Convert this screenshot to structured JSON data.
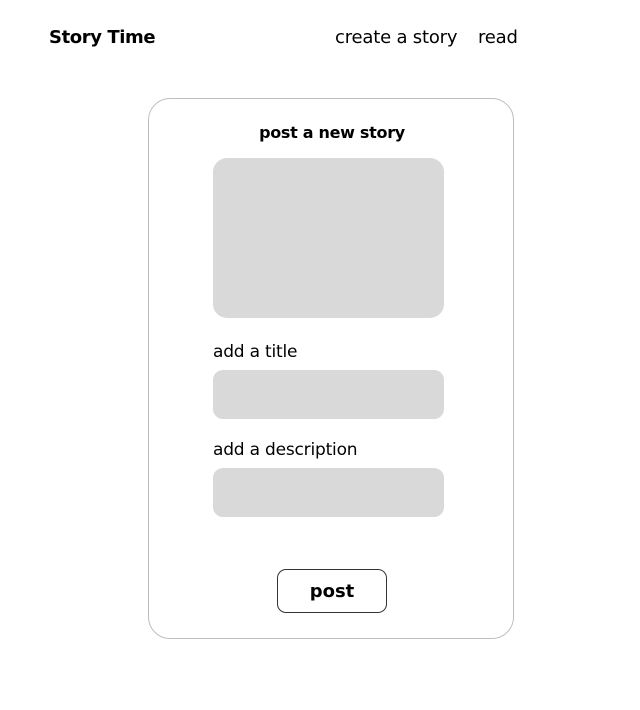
{
  "header": {
    "brand": "Story Time",
    "nav": {
      "create_label": "create a story",
      "read_label": "read"
    }
  },
  "form": {
    "title": "post a new story",
    "title_field": {
      "label": "add a title",
      "value": "",
      "placeholder": ""
    },
    "description_field": {
      "label": "add a description",
      "value": "",
      "placeholder": ""
    },
    "submit_label": "post"
  },
  "colors": {
    "placeholder_fill": "#d9d9d9",
    "card_border": "#bdbdbd",
    "button_border": "#333333"
  }
}
